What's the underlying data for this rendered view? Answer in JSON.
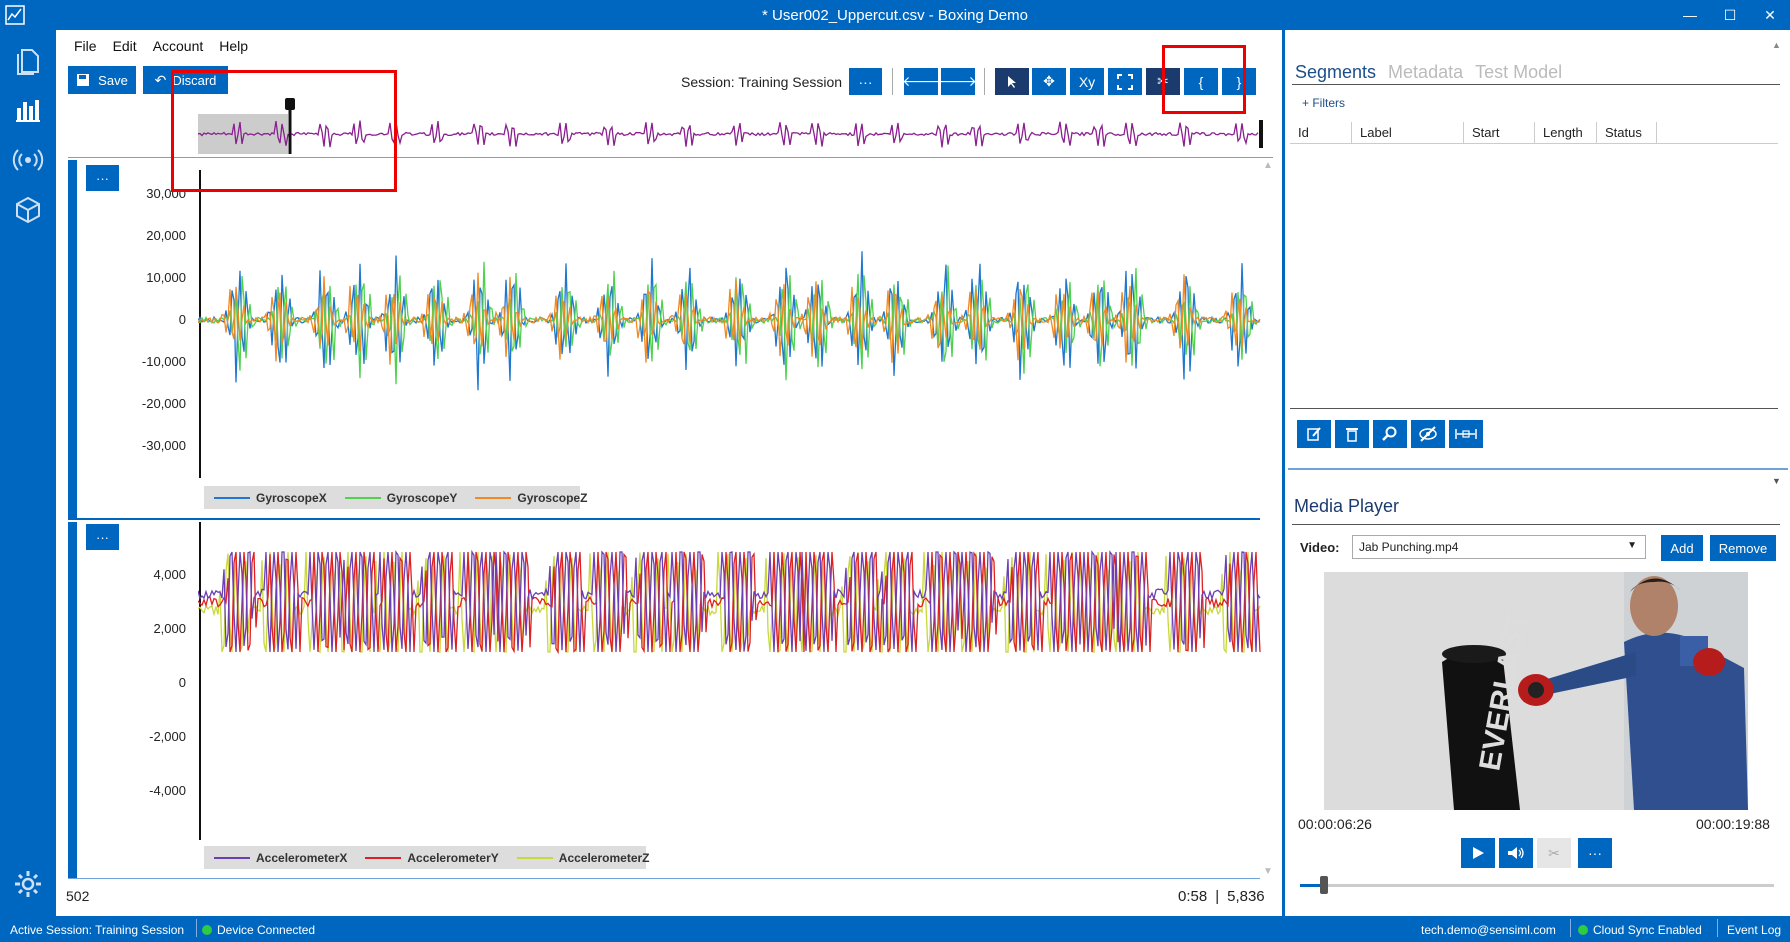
{
  "window": {
    "title": "* User002_Uppercut.csv - Boxing Demo"
  },
  "window_controls": {
    "minimize": "—",
    "maximize": "☐",
    "close": "✕"
  },
  "menu": [
    "File",
    "Edit",
    "Account",
    "Help"
  ],
  "toolbar": {
    "save_label": "Save",
    "discard_label": "Discard",
    "session_label": "Session:  Training Session",
    "more_label": "···",
    "xy_label": "Xy",
    "start_bracket_label": "{",
    "end_bracket_label": "}"
  },
  "gyro_plot": {
    "more_label": "···",
    "y_ticks": [
      "30,000",
      "20,000",
      "10,000",
      "0",
      "-10,000",
      "-20,000",
      "-30,000"
    ],
    "legend": [
      {
        "name": "GyroscopeX",
        "color": "#1f77d0"
      },
      {
        "name": "GyroscopeY",
        "color": "#4fd14f"
      },
      {
        "name": "GyroscopeZ",
        "color": "#f08a24"
      }
    ]
  },
  "accel_plot": {
    "more_label": "···",
    "y_ticks": [
      "4,000",
      "2,000",
      "0",
      "-2,000",
      "-4,000"
    ],
    "legend": [
      {
        "name": "AccelerometerX",
        "color": "#6a3fb5"
      },
      {
        "name": "AccelerometerY",
        "color": "#e02020"
      },
      {
        "name": "AccelerometerZ",
        "color": "#c8d83a"
      }
    ]
  },
  "plot_footer": {
    "position": "502",
    "time": "0:58",
    "divider": "|",
    "samples": "5,836"
  },
  "right_panel": {
    "tabs": [
      "Segments",
      "Metadata",
      "Test Model"
    ],
    "filters_label": "+ Filters",
    "columns": [
      "Id",
      "Label",
      "Start",
      "Length",
      "Status"
    ]
  },
  "media_player": {
    "title": "Media Player",
    "video_label": "Video:",
    "video_file": "Jab Punching.mp4",
    "add_label": "Add",
    "remove_label": "Remove",
    "current_time": "00:00:06:26",
    "total_time": "00:00:19:88",
    "more_label": "···",
    "progress": 0.05
  },
  "status_bar": {
    "active_session": "Active Session:  Training Session",
    "device": "Device Connected",
    "user": "tech.demo@sensiml.com",
    "cloud": "Cloud Sync Enabled",
    "event_log": "Event Log"
  }
}
